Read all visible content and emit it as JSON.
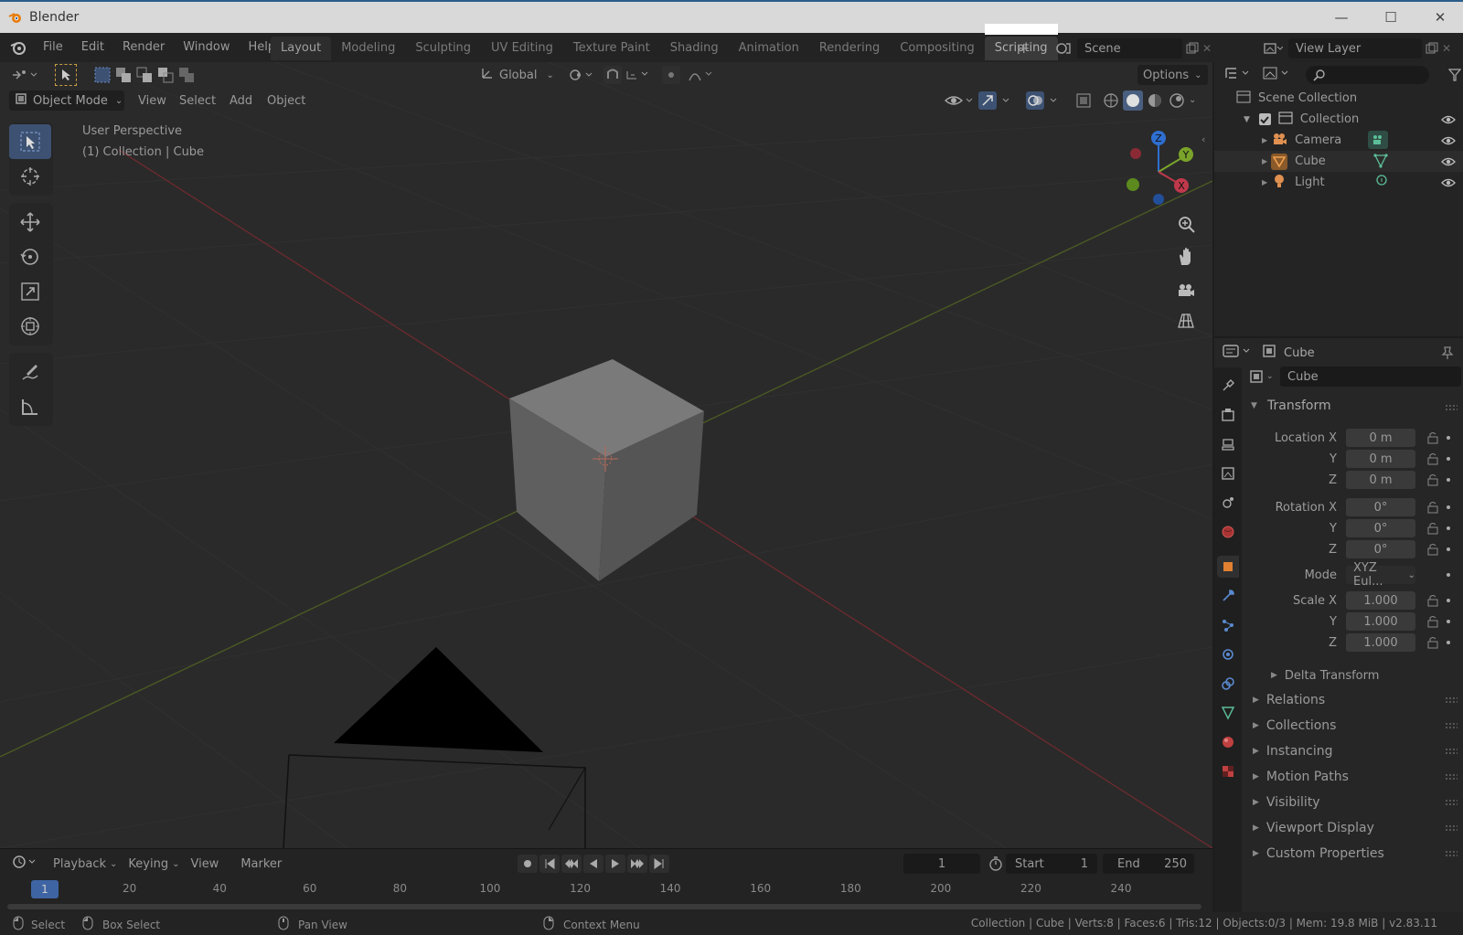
{
  "window": {
    "title": "Blender",
    "minimize": "—",
    "maximize": "☐",
    "close": "✕"
  },
  "menubar": {
    "items": [
      "File",
      "Edit",
      "Render",
      "Window",
      "Help"
    ],
    "workspaces": [
      "Layout",
      "Modeling",
      "Sculpting",
      "UV Editing",
      "Texture Paint",
      "Shading",
      "Animation",
      "Rendering",
      "Compositing",
      "Scripting"
    ],
    "active_workspace": "Layout",
    "add_label": "+",
    "scene": "Scene",
    "view_layer": "View Layer"
  },
  "viewport": {
    "mode": "Object Mode",
    "menus": [
      "View",
      "Select",
      "Add",
      "Object"
    ],
    "orientation": "Global",
    "options_label": "Options",
    "perspective_label": "User Perspective",
    "collection_label": "(1) Collection | Cube",
    "gizmo_axes": {
      "x": "X",
      "y": "Y",
      "z": "Z"
    },
    "colors": {
      "x_axis": "#c0394b",
      "y_axis": "#7aa32a",
      "z_axis": "#2f6fd1",
      "select": "#3d5273"
    }
  },
  "timeline": {
    "menus": [
      "Playback",
      "Keying",
      "View",
      "Marker"
    ],
    "current_frame": "1",
    "start_label": "Start",
    "start_value": "1",
    "end_label": "End",
    "end_value": "250",
    "ruler_current": "1",
    "ticks": [
      "20",
      "40",
      "60",
      "80",
      "100",
      "120",
      "140",
      "160",
      "180",
      "200",
      "220",
      "240"
    ]
  },
  "statusbar": {
    "select": "Select",
    "box_select": "Box Select",
    "pan_view": "Pan View",
    "context_menu": "Context Menu",
    "stats": "Collection | Cube | Verts:8 | Faces:6 | Tris:12 | Objects:0/3 | Mem: 19.8 MiB | v2.83.11"
  },
  "outliner": {
    "root": "Scene Collection",
    "collection": "Collection",
    "objects": [
      "Camera",
      "Cube",
      "Light"
    ]
  },
  "properties": {
    "header_object": "Cube",
    "object_name": "Cube",
    "transform_title": "Transform",
    "location": {
      "label": "Location X",
      "x": "0 m",
      "y": "0 m",
      "z": "0 m"
    },
    "rotation": {
      "label": "Rotation X",
      "x": "0°",
      "y": "0°",
      "z": "0°"
    },
    "mode_label": "Mode",
    "mode_value": "XYZ Eul...",
    "scale": {
      "label": "Scale X",
      "x": "1.000",
      "y": "1.000",
      "z": "1.000"
    },
    "axis_labels": {
      "y": "Y",
      "z": "Z"
    },
    "delta_transform": "Delta Transform",
    "panels": [
      "Relations",
      "Collections",
      "Instancing",
      "Motion Paths",
      "Visibility",
      "Viewport Display",
      "Custom Properties"
    ]
  }
}
